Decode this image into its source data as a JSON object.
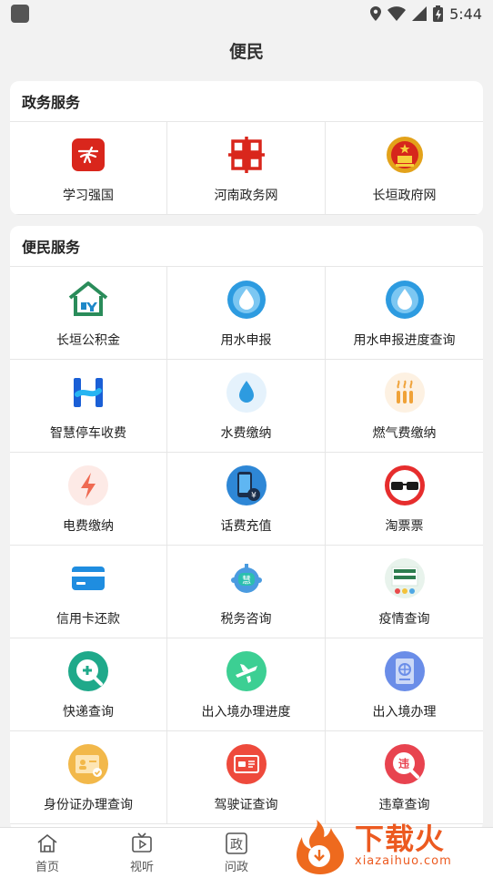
{
  "status": {
    "time": "5:44"
  },
  "header": {
    "title": "便民"
  },
  "sections": [
    {
      "title": "政务服务",
      "items": [
        {
          "label": "学习强国",
          "icon": "xuexi-qiangguo-icon"
        },
        {
          "label": "河南政务网",
          "icon": "henan-gov-icon"
        },
        {
          "label": "长垣政府网",
          "icon": "national-emblem-icon"
        }
      ]
    },
    {
      "title": "便民服务",
      "items": [
        {
          "label": "长垣公积金",
          "icon": "housing-fund-icon"
        },
        {
          "label": "用水申报",
          "icon": "water-drop-icon"
        },
        {
          "label": "用水申报进度查询",
          "icon": "water-drop-icon"
        },
        {
          "label": "智慧停车收费",
          "icon": "smart-parking-icon"
        },
        {
          "label": "水费缴纳",
          "icon": "water-fee-icon"
        },
        {
          "label": "燃气费缴纳",
          "icon": "gas-fee-icon"
        },
        {
          "label": "电费缴纳",
          "icon": "electricity-icon"
        },
        {
          "label": "话费充值",
          "icon": "phone-recharge-icon"
        },
        {
          "label": "淘票票",
          "icon": "taopiaopiao-icon"
        },
        {
          "label": "信用卡还款",
          "icon": "credit-card-icon"
        },
        {
          "label": "税务咨询",
          "icon": "tax-robot-icon"
        },
        {
          "label": "疫情查询",
          "icon": "epidemic-query-icon"
        },
        {
          "label": "快递查询",
          "icon": "express-query-icon"
        },
        {
          "label": "出入境办理进度",
          "icon": "airplane-icon"
        },
        {
          "label": "出入境办理",
          "icon": "passport-icon"
        },
        {
          "label": "身份证办理查询",
          "icon": "id-card-icon"
        },
        {
          "label": "驾驶证查询",
          "icon": "driver-license-icon"
        },
        {
          "label": "违章查询",
          "icon": "violation-icon"
        }
      ]
    }
  ],
  "nav": [
    {
      "label": "首页",
      "icon": "home-icon"
    },
    {
      "label": "视听",
      "icon": "tv-icon"
    },
    {
      "label": "问政",
      "icon": "zheng-icon"
    }
  ],
  "watermark": {
    "cn": "下载火",
    "en": "xiazaihuo.com"
  },
  "colors": {
    "background": "#f2f2f2",
    "card": "#ffffff",
    "watermark": "#ec5a20"
  }
}
